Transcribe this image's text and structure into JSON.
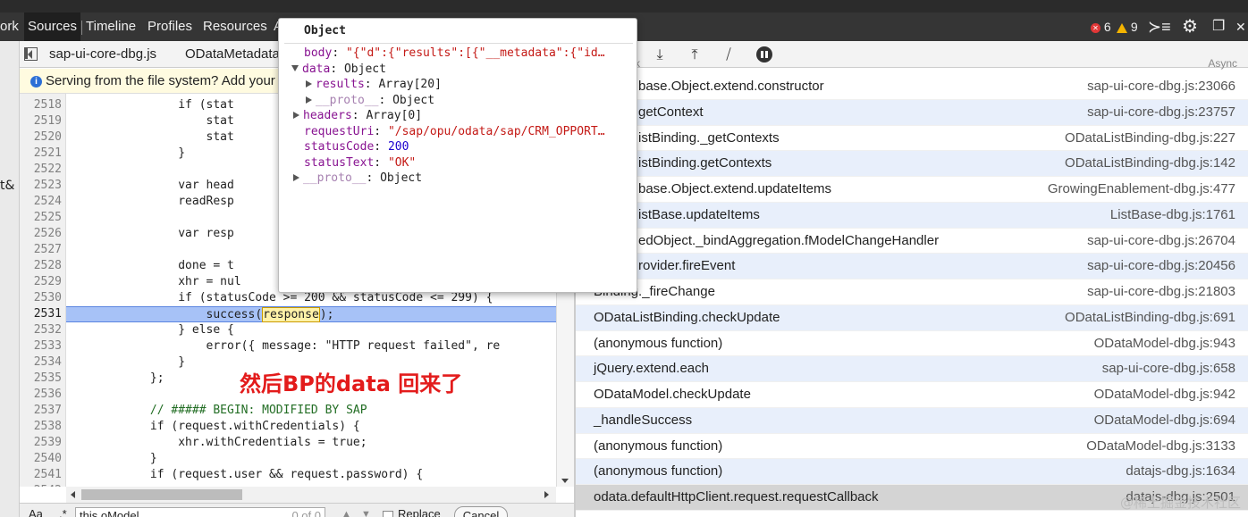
{
  "toolbar": {
    "tabs": [
      "ork",
      "Sources",
      "Timeline",
      "Profiles",
      "Resources",
      "A"
    ],
    "active_tab": "Sources",
    "error_count": "6",
    "warning_count": "9"
  },
  "file_tabs": [
    "sap-ui-core-dbg.js",
    "ODataMetadata"
  ],
  "info_bar": {
    "text": "Serving from the file system? Add your"
  },
  "left_gutter_text": "t&",
  "editor": {
    "line_numbers": [
      "2518",
      "2519",
      "2520",
      "2521",
      "2522",
      "2523",
      "2524",
      "2525",
      "2526",
      "2527",
      "2528",
      "2529",
      "2530",
      "2531",
      "2532",
      "2533",
      "2534",
      "2535",
      "2536",
      "2537",
      "2538",
      "2539",
      "2540",
      "2541",
      "2542"
    ],
    "lines": [
      "                if (stat",
      "                    stat",
      "                    stat",
      "                }",
      "",
      "                var head",
      "                readResp",
      "",
      "                var resp",
      "",
      "                done = t",
      "                xhr = nul",
      "                if (statusCode >= 200 && statusCode <= 299) {",
      "                    success(response);",
      "                } else {",
      "                    error({ message: \"HTTP request failed\", re",
      "                }",
      "            };",
      "",
      "            // ##### BEGIN: MODIFIED BY SAP",
      "            if (request.withCredentials) {",
      "                xhr.withCredentials = true;",
      "            }",
      "            if (request.user && request.password) {",
      ""
    ],
    "highlighted_line": "2531"
  },
  "annotation": "然后BP的data 回来了",
  "search": {
    "aa": "Aa",
    "dot": ".*",
    "query": "this.oModel",
    "count": "0 of 0",
    "replace_label": "Replace",
    "cancel_label": "Cancel"
  },
  "callstack_header": {
    "left": "ck",
    "right": "Async"
  },
  "callstack": [
    {
      "fn": "base.Object.extend.constructor",
      "loc": "sap-ui-core-dbg.js:23066"
    },
    {
      "fn": "getContext",
      "loc": "sap-ui-core-dbg.js:23757"
    },
    {
      "fn": "istBinding._getContexts",
      "loc": "ODataListBinding-dbg.js:227"
    },
    {
      "fn": "istBinding.getContexts",
      "loc": "ODataListBinding-dbg.js:142"
    },
    {
      "fn": "base.Object.extend.updateItems",
      "loc": "GrowingEnablement-dbg.js:477"
    },
    {
      "fn": "istBase.updateItems",
      "loc": "ListBase-dbg.js:1761"
    },
    {
      "fn": "edObject._bindAggregation.fModelChangeHandler",
      "loc": "sap-ui-core-dbg.js:26704"
    },
    {
      "fn": "rovider.fireEvent",
      "loc": "sap-ui-core-dbg.js:20456"
    },
    {
      "fn": "Binding._fireChange",
      "loc": "sap-ui-core-dbg.js:21803"
    },
    {
      "fn": "ODataListBinding.checkUpdate",
      "loc": "ODataListBinding-dbg.js:691"
    },
    {
      "fn": "(anonymous function)",
      "loc": "ODataModel-dbg.js:943"
    },
    {
      "fn": "jQuery.extend.each",
      "loc": "sap-ui-core-dbg.js:658"
    },
    {
      "fn": "ODataModel.checkUpdate",
      "loc": "ODataModel-dbg.js:942"
    },
    {
      "fn": "_handleSuccess",
      "loc": "ODataModel-dbg.js:694"
    },
    {
      "fn": "(anonymous function)",
      "loc": "ODataModel-dbg.js:3133"
    },
    {
      "fn": "(anonymous function)",
      "loc": "datajs-dbg.js:1634"
    },
    {
      "fn": "odata.defaultHttpClient.request.requestCallback",
      "loc": "datajs-dbg.js:2501"
    }
  ],
  "watermark": "@稀土掘金技术社区",
  "popover": {
    "title": "Object",
    "body_key": "body",
    "body_val": "\"{\"d\":{\"results\":[{\"__metadata\":{\"id…",
    "data_key": "data",
    "data_val": "Object",
    "results_key": "results",
    "results_val": "Array[20]",
    "proto1_key": "__proto__",
    "proto1_val": "Object",
    "headers_key": "headers",
    "headers_val": "Array[0]",
    "requestUri_key": "requestUri",
    "requestUri_val": "\"/sap/opu/odata/sap/CRM_OPPORT…",
    "statusCode_key": "statusCode",
    "statusCode_val": "200",
    "statusText_key": "statusText",
    "statusText_val": "\"OK\"",
    "proto2_key": "__proto__",
    "proto2_val": "Object"
  },
  "colors": {
    "toolbar_bg": "#353535",
    "highlight_line": "#a7c2f7",
    "row_alt": "#e8effb",
    "annotation": "#e31b1b"
  }
}
